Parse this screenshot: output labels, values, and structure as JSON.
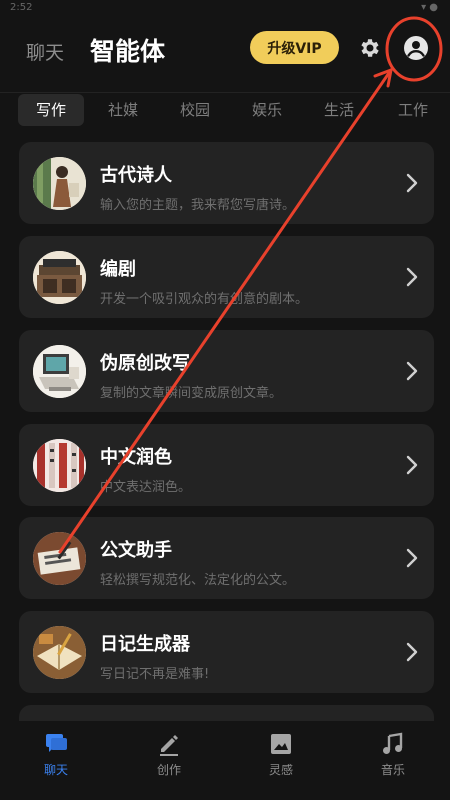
{
  "status_bar": {
    "time": "2:52",
    "icons": "▾ ●"
  },
  "header": {
    "chat_tab": "聊天",
    "agent_tab": "智能体",
    "vip_label": "升级VIP"
  },
  "categories": [
    "写作",
    "社媒",
    "校园",
    "娱乐",
    "生活",
    "工作"
  ],
  "active_category": "写作",
  "cards": [
    {
      "title": "古代诗人",
      "desc": "输入您的主题，我来帮您写唐诗。"
    },
    {
      "title": "编剧",
      "desc": "开发一个吸引观众的有创意的剧本。"
    },
    {
      "title": "伪原创改写",
      "desc": "复制的文章瞬间变成原创文章。"
    },
    {
      "title": "中文润色",
      "desc": "中文表达润色。"
    },
    {
      "title": "公文助手",
      "desc": "轻松撰写规范化、法定化的公文。"
    },
    {
      "title": "日记生成器",
      "desc": "写日记不再是难事!"
    }
  ],
  "bottom_nav": [
    {
      "label": "聊天",
      "icon": "chat-icon",
      "active": true
    },
    {
      "label": "创作",
      "icon": "pencil-icon",
      "active": false
    },
    {
      "label": "灵感",
      "icon": "image-icon",
      "active": false
    },
    {
      "label": "音乐",
      "icon": "music-icon",
      "active": false
    }
  ],
  "colors": {
    "background": "#141414",
    "card": "#232323",
    "vip": "#f1cd5a",
    "accent_blue": "#3b82f0",
    "annotation_red": "#e8412c"
  }
}
